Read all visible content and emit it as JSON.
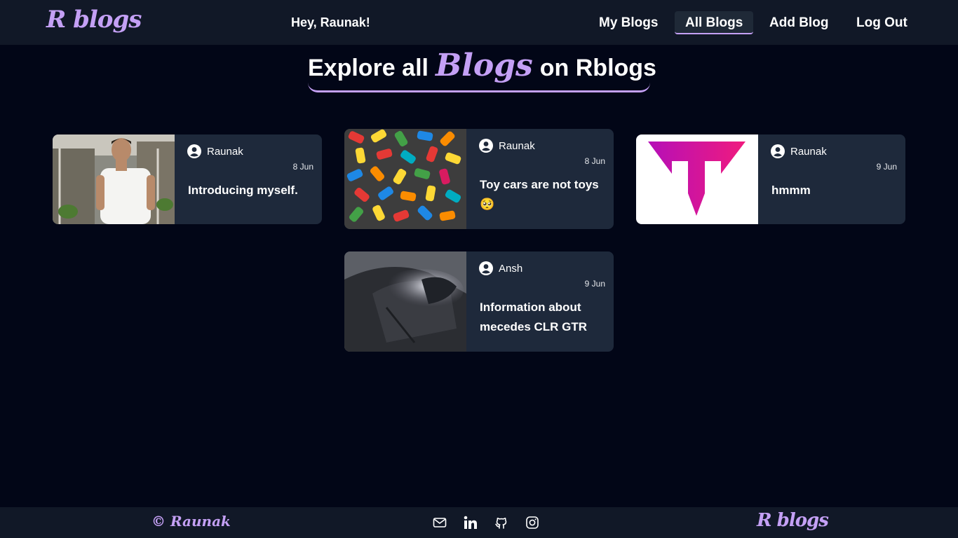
{
  "navbar": {
    "logo": "R blogs",
    "greeting": "Hey, Raunak!",
    "links": [
      {
        "label": "My Blogs",
        "active": false
      },
      {
        "label": "All Blogs",
        "active": true
      },
      {
        "label": "Add Blog",
        "active": false
      },
      {
        "label": "Log Out",
        "active": false
      }
    ]
  },
  "hero": {
    "prefix": "Explore all",
    "accent": "Blogs",
    "suffix": "on Rblogs"
  },
  "blogs": [
    {
      "author": "Raunak",
      "date": "8 Jun",
      "title": "Introducing myself.",
      "thumbnail": "portrait-photo"
    },
    {
      "author": "Raunak",
      "date": "8 Jun",
      "title": "Toy cars are not toys 🥺",
      "thumbnail": "toy-cars-photo"
    },
    {
      "author": "Raunak",
      "date": "9 Jun",
      "title": "hmmm",
      "thumbnail": "pink-t-logo"
    },
    {
      "author": "Ansh",
      "date": "9 Jun",
      "title": "Information about mecedes CLR GTR",
      "thumbnail": "anime-illustration"
    }
  ],
  "footer": {
    "copyright": "© Raunak",
    "logo": "R blogs",
    "social_icons": [
      "mail-icon",
      "linkedin-icon",
      "github-icon",
      "instagram-icon"
    ]
  },
  "colors": {
    "background": "#020617",
    "surface": "#1e293b",
    "navbar": "#111827",
    "accent": "#c4a0f5"
  }
}
